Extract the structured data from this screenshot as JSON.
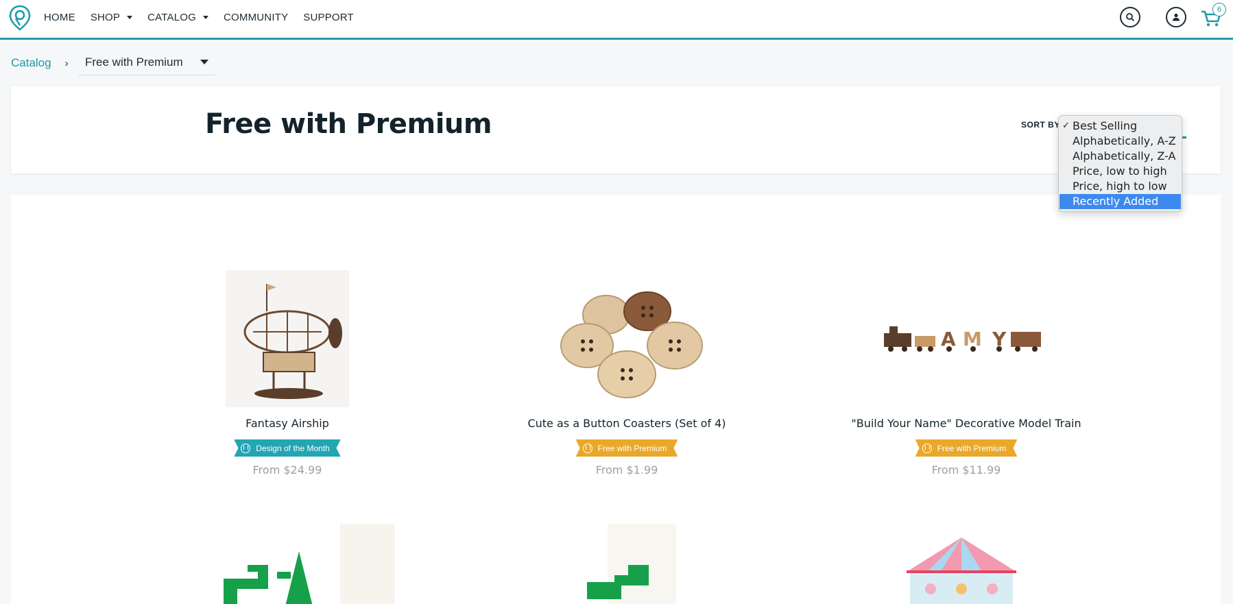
{
  "nav": {
    "items": [
      {
        "label": "HOME",
        "has_caret": false
      },
      {
        "label": "SHOP",
        "has_caret": true
      },
      {
        "label": "CATALOG",
        "has_caret": true
      },
      {
        "label": "COMMUNITY",
        "has_caret": false
      },
      {
        "label": "SUPPORT",
        "has_caret": false
      }
    ],
    "cart_count": "6",
    "accent_color": "#1a9aaa"
  },
  "breadcrumb": {
    "root": "Catalog",
    "separator": "›",
    "current": "Free with Premium"
  },
  "header": {
    "title": "Free with Premium",
    "sort_label": "SORT BY"
  },
  "sort_dropdown": {
    "options": [
      {
        "label": "Best Selling",
        "checked": true,
        "highlighted": false
      },
      {
        "label": "Alphabetically, A-Z",
        "checked": false,
        "highlighted": false
      },
      {
        "label": "Alphabetically, Z-A",
        "checked": false,
        "highlighted": false
      },
      {
        "label": "Price, low to high",
        "checked": false,
        "highlighted": false
      },
      {
        "label": "Price, high to low",
        "checked": false,
        "highlighted": false
      },
      {
        "label": "Recently Added",
        "checked": false,
        "highlighted": true
      }
    ],
    "check_glyph": "✓"
  },
  "products": [
    {
      "name": "Fantasy Airship",
      "badge": "Design of the Month",
      "badge_color": "#24a5b2",
      "price": "From $24.99"
    },
    {
      "name": "Cute as a Button Coasters (Set of 4)",
      "badge": "Free with Premium",
      "badge_color": "#e9a82a",
      "price": "From $1.99"
    },
    {
      "name": "\"Build Your Name\" Decorative Model Train",
      "badge": "Free with Premium",
      "badge_color": "#e9a82a",
      "price": "From $11.99"
    }
  ]
}
